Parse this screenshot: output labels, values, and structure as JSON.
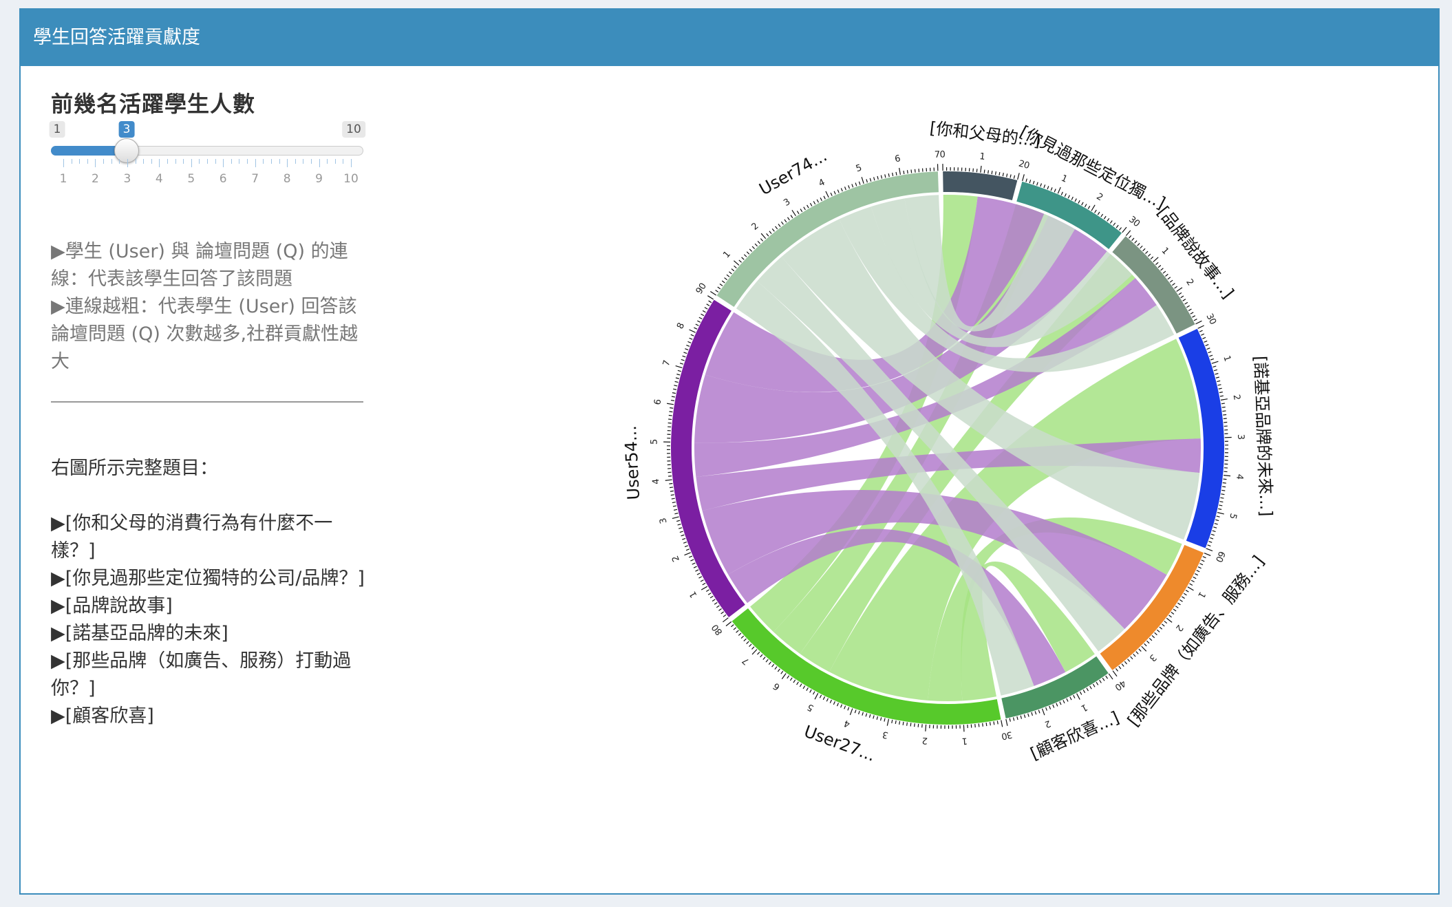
{
  "panel": {
    "title": "學生回答活躍貢獻度"
  },
  "slider": {
    "label": "前幾名活躍學生人數",
    "min": 1,
    "max": 10,
    "value": 3,
    "min_label": "1",
    "max_label": "10",
    "value_label": "3",
    "tick_labels": [
      "1",
      "2",
      "3",
      "4",
      "5",
      "6",
      "7",
      "8",
      "9",
      "10"
    ]
  },
  "description": {
    "line1": "▶學生 (User) 與 論壇問題 (Q) 的連線：代表該學生回答了該問題",
    "line2": "▶連線越粗：代表學生 (User) 回答該論壇問題 (Q) 次數越多,社群貢獻性越大"
  },
  "full_questions": {
    "heading": "右圖所示完整題目：",
    "items": [
      "▶[你和父母的消費行為有什麼不一樣？]",
      "▶[你見過那些定位獨特的公司/品牌？]",
      "▶[品牌說故事]",
      "▶[諾基亞品牌的未來]",
      "▶[那些品牌（如廣告、服務）打動過你？]",
      "▶[顧客欣喜]"
    ]
  },
  "chart_data": {
    "type": "chord",
    "sectors": [
      {
        "name": "User27...",
        "total": 80,
        "color": "#57c92b"
      },
      {
        "name": "User54...",
        "total": 90,
        "color": "#7b1fa2"
      },
      {
        "name": "User74...",
        "total": 70,
        "color": "#9ec4a3"
      },
      {
        "name": "[你和父母的...]",
        "total": 20,
        "color": "#445561"
      },
      {
        "name": "[你見過那些定位獨...]",
        "total": 30,
        "color": "#3e9588"
      },
      {
        "name": "[品牌說故事...]",
        "total": 30,
        "color": "#7b9482"
      },
      {
        "name": "[諾基亞品牌的未來...]",
        "total": 60,
        "color": "#1a3ee6"
      },
      {
        "name": "[那些品牌（如廣告、服務...]",
        "total": 40,
        "color": "#ee8a2c"
      },
      {
        "name": "[顧客欣喜...]",
        "total": 30,
        "color": "#4b9563"
      }
    ],
    "tick_unit": 10,
    "links": [
      {
        "user": "User27...",
        "question": "[顧客欣喜...]",
        "value": 10,
        "color": "#a6e384"
      },
      {
        "user": "User27...",
        "question": "[那些品牌（如廣告、服務...]",
        "value": 10,
        "color": "#a6e384"
      },
      {
        "user": "User27...",
        "question": "[諾基亞品牌的未來...]",
        "value": 30,
        "color": "#a6e384"
      },
      {
        "user": "User27...",
        "question": "[品牌說故事...]",
        "value": 10,
        "color": "#a6e384"
      },
      {
        "user": "User27...",
        "question": "[你見過那些定位獨...]",
        "value": 10,
        "color": "#a6e384"
      },
      {
        "user": "User27...",
        "question": "[你和父母的...]",
        "value": 10,
        "color": "#a6e384"
      },
      {
        "user": "User54...",
        "question": "[顧客欣喜...]",
        "value": 10,
        "color": "#b37ccd"
      },
      {
        "user": "User54...",
        "question": "[那些品牌（如廣告、服務...]",
        "value": 20,
        "color": "#b37ccd"
      },
      {
        "user": "User54...",
        "question": "[諾基亞品牌的未來...]",
        "value": 10,
        "color": "#b37ccd"
      },
      {
        "user": "User54...",
        "question": "[品牌說故事...]",
        "value": 10,
        "color": "#b37ccd"
      },
      {
        "user": "User54...",
        "question": "[你見過那些定位獨...]",
        "value": 20,
        "color": "#b37ccd"
      },
      {
        "user": "User54...",
        "question": "[你和父母的...]",
        "value": 20,
        "color": "#b37ccd"
      },
      {
        "user": "User74...",
        "question": "[顧客欣喜...]",
        "value": 10,
        "color": "#c9dccb"
      },
      {
        "user": "User74...",
        "question": "[那些品牌（如廣告、服務...]",
        "value": 10,
        "color": "#c9dccb"
      },
      {
        "user": "User74...",
        "question": "[諾基亞品牌的未來...]",
        "value": 20,
        "color": "#c9dccb"
      },
      {
        "user": "User74...",
        "question": "[品牌說故事...]",
        "value": 10,
        "color": "#c9dccb"
      },
      {
        "user": "User74...",
        "question": "[你見過那些定位獨...]",
        "value": 10,
        "color": "#c9dccb"
      },
      {
        "user": "User74...",
        "question": "[你和父母的...]",
        "value": 10,
        "color": "#c9dccb"
      }
    ]
  }
}
